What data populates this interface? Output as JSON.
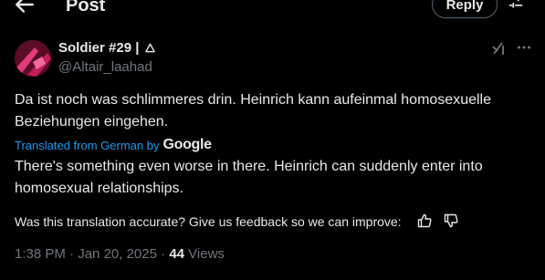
{
  "header": {
    "title": "Post",
    "reply_label": "Reply"
  },
  "post": {
    "author_name": "Soldier #29 |",
    "author_handle": "@Altair_laahad",
    "original_text": "Da ist noch was schlimmeres drin. Heinrich kann aufeinmal homosexuelle Beziehungen eingehen.",
    "translated_from": "Translated from German by",
    "translator_brand": "Google",
    "translated_text": "There's something even worse in there. Heinrich can suddenly enter into homosexual relationships.",
    "feedback_prompt": "Was this translation accurate? Give us feedback so we can improve:",
    "time": "1:38 PM",
    "date": "Jan 20, 2025",
    "views_count": "44",
    "views_label": "Views"
  },
  "icons": [
    "back-arrow-icon",
    "filter-icon",
    "triangle-icon",
    "grok-icon",
    "more-icon",
    "thumbs-up-icon",
    "thumbs-down-icon"
  ],
  "colors": {
    "background": "#000000",
    "text": "#e7e9ea",
    "secondary": "#71767b",
    "link": "#1d9bf0"
  }
}
